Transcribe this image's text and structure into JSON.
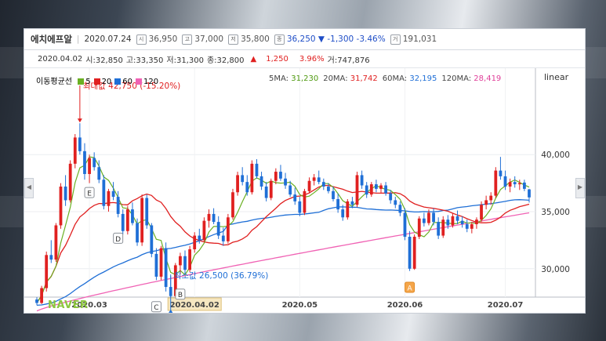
{
  "header": {
    "stock_name": "에치에프알",
    "date": "2020.07.24",
    "open_label": "시",
    "open": "36,950",
    "high_label": "고",
    "high": "37,000",
    "low_label": "저",
    "low": "35,800",
    "close_label": "종",
    "close": "36,250",
    "change_arrow": "▼",
    "change": "-1,300",
    "change_pct": "-3.46%",
    "volume_label": "거",
    "volume": "191,031"
  },
  "infobar": {
    "date": "2020.04.02",
    "open": "시:32,850",
    "high": "고:33,350",
    "low": "저:31,300",
    "close": "종:32,800",
    "arrow": "▲",
    "change": "1,250",
    "change_pct": "3.96%",
    "volume": "거:747,876"
  },
  "legend": {
    "title": "이동평균선",
    "items": [
      {
        "label": "5",
        "color": "#6ab023"
      },
      {
        "label": "20",
        "color": "#e02020"
      },
      {
        "label": "60",
        "color": "#1f6fd6"
      },
      {
        "label": "120",
        "color": "#f062b4"
      }
    ],
    "ma_values": [
      {
        "label": "5MA:",
        "value": "31,230",
        "color": "#4f9a10"
      },
      {
        "label": "20MA:",
        "value": "31,742",
        "color": "#e02020"
      },
      {
        "label": "60MA:",
        "value": "32,195",
        "color": "#1f6fd6"
      },
      {
        "label": "120MA:",
        "value": "28,419",
        "color": "#e0409a"
      }
    ],
    "scale": "linear"
  },
  "annotations": {
    "max": "최대값 42,750 (-15.20%)",
    "min": "최소값 26,500 (36.79%)",
    "markers": [
      "A",
      "B",
      "C",
      "D",
      "E"
    ]
  },
  "watermark": "NAVER",
  "chart_data": {
    "type": "candlestick",
    "y_ticks": [
      "40,000",
      "35,000",
      "30,000"
    ],
    "ylim": [
      25000,
      45000
    ],
    "x_ticks": [
      "2020.03",
      "2020.04.02",
      "2020.05",
      "2020.06",
      "2020.07"
    ],
    "highlight_date": "2020.04.02",
    "ohlc": [
      [
        27300,
        27500,
        26800,
        27000
      ],
      [
        27000,
        28500,
        26900,
        28300
      ],
      [
        28300,
        31500,
        28000,
        31200
      ],
      [
        31200,
        32500,
        30500,
        30800
      ],
      [
        30800,
        34000,
        30600,
        33800
      ],
      [
        33800,
        37500,
        33500,
        37200
      ],
      [
        37200,
        38200,
        35500,
        36000
      ],
      [
        36000,
        39500,
        35800,
        39200
      ],
      [
        39200,
        41800,
        38800,
        41500
      ],
      [
        41500,
        42750,
        40000,
        40300
      ],
      [
        40300,
        41000,
        37800,
        38300
      ],
      [
        38300,
        40000,
        37500,
        39700
      ],
      [
        39700,
        40200,
        38600,
        38900
      ],
      [
        38900,
        39500,
        37500,
        37800
      ],
      [
        37800,
        38200,
        35200,
        35500
      ],
      [
        35500,
        37000,
        35000,
        36800
      ],
      [
        36800,
        37600,
        36000,
        36300
      ],
      [
        36300,
        36800,
        34500,
        34800
      ],
      [
        34800,
        35200,
        33000,
        33300
      ],
      [
        33300,
        35500,
        33000,
        35200
      ],
      [
        35200,
        35800,
        33800,
        34000
      ],
      [
        34000,
        34400,
        32000,
        32300
      ],
      [
        32300,
        36500,
        32000,
        36200
      ],
      [
        36200,
        36500,
        33500,
        33800
      ],
      [
        33800,
        34000,
        31000,
        31300
      ],
      [
        31300,
        31800,
        29000,
        29300
      ],
      [
        29300,
        32000,
        29000,
        31800
      ],
      [
        31800,
        32300,
        28000,
        28400
      ],
      [
        28400,
        29500,
        26500,
        27600
      ],
      [
        27600,
        30500,
        27300,
        30300
      ],
      [
        30300,
        31400,
        29500,
        31100
      ],
      [
        31100,
        31600,
        29600,
        29900
      ],
      [
        29900,
        32000,
        29700,
        31700
      ],
      [
        31700,
        33200,
        31400,
        32900
      ],
      [
        32900,
        33500,
        32200,
        32500
      ],
      [
        32500,
        34500,
        32300,
        34200
      ],
      [
        34200,
        35200,
        33600,
        34800
      ],
      [
        34800,
        35300,
        33900,
        34100
      ],
      [
        34100,
        34600,
        32600,
        32900
      ],
      [
        32900,
        33600,
        32000,
        32400
      ],
      [
        32400,
        34800,
        32200,
        34500
      ],
      [
        34500,
        37000,
        34300,
        36700
      ],
      [
        36700,
        38500,
        36400,
        38200
      ],
      [
        38200,
        38900,
        37300,
        37600
      ],
      [
        37600,
        38200,
        36400,
        36700
      ],
      [
        36700,
        39500,
        36500,
        39200
      ],
      [
        39200,
        39600,
        37900,
        38100
      ],
      [
        38100,
        38500,
        36900,
        37200
      ],
      [
        37200,
        37600,
        35900,
        36200
      ],
      [
        36200,
        37900,
        36000,
        37700
      ],
      [
        37700,
        38800,
        37400,
        38500
      ],
      [
        38500,
        39100,
        37700,
        37900
      ],
      [
        37900,
        38400,
        37000,
        37300
      ],
      [
        37300,
        37700,
        36300,
        36500
      ],
      [
        36500,
        37100,
        35600,
        35900
      ],
      [
        35900,
        36300,
        34600,
        34900
      ],
      [
        34900,
        37000,
        34700,
        36800
      ],
      [
        36800,
        38000,
        36600,
        37700
      ],
      [
        37700,
        38300,
        37300,
        38000
      ],
      [
        38000,
        38600,
        37400,
        37600
      ],
      [
        37600,
        37900,
        36900,
        37200
      ],
      [
        37200,
        37500,
        36600,
        36800
      ],
      [
        36800,
        37200,
        35900,
        36100
      ],
      [
        36100,
        36600,
        34900,
        35200
      ],
      [
        35200,
        35600,
        34200,
        34500
      ],
      [
        34500,
        36100,
        34300,
        35900
      ],
      [
        35900,
        36300,
        35300,
        35600
      ],
      [
        35600,
        38500,
        35400,
        38200
      ],
      [
        38200,
        38600,
        37000,
        37300
      ],
      [
        37300,
        37600,
        36200,
        36500
      ],
      [
        36500,
        37600,
        36300,
        37400
      ],
      [
        37400,
        37800,
        36700,
        37000
      ],
      [
        37000,
        37500,
        36600,
        37300
      ],
      [
        37300,
        37600,
        36400,
        36600
      ],
      [
        36600,
        36900,
        35700,
        36000
      ],
      [
        36000,
        36300,
        35300,
        35600
      ],
      [
        35600,
        35900,
        34600,
        34900
      ],
      [
        34900,
        35300,
        32500,
        32800
      ],
      [
        32800,
        33300,
        29800,
        30000
      ],
      [
        30000,
        33000,
        29900,
        32800
      ],
      [
        32800,
        34600,
        32600,
        34400
      ],
      [
        34400,
        34900,
        33700,
        34000
      ],
      [
        34000,
        35200,
        33800,
        34900
      ],
      [
        34900,
        35300,
        33800,
        34100
      ],
      [
        34100,
        34500,
        32600,
        32900
      ],
      [
        32900,
        34600,
        32700,
        34300
      ],
      [
        34300,
        34700,
        33500,
        33800
      ],
      [
        33800,
        34900,
        33600,
        34600
      ],
      [
        34600,
        35100,
        33900,
        34200
      ],
      [
        34200,
        34600,
        33600,
        33900
      ],
      [
        33900,
        34300,
        33200,
        33500
      ],
      [
        33500,
        34100,
        33100,
        33900
      ],
      [
        33900,
        34500,
        33500,
        34300
      ],
      [
        34300,
        35900,
        34100,
        35600
      ],
      [
        35600,
        36400,
        35200,
        36000
      ],
      [
        36000,
        36700,
        35600,
        36400
      ],
      [
        36400,
        38900,
        36200,
        38600
      ],
      [
        38600,
        39800,
        37800,
        38100
      ],
      [
        38100,
        38600,
        36900,
        37200
      ],
      [
        37200,
        37900,
        36700,
        37600
      ],
      [
        37600,
        38100,
        37100,
        37400
      ],
      [
        37400,
        37800,
        36900,
        37500
      ],
      [
        37550,
        37800,
        36800,
        37000
      ],
      [
        36950,
        37000,
        35800,
        36250
      ]
    ],
    "ma120": [
      26300,
      34900
    ]
  }
}
